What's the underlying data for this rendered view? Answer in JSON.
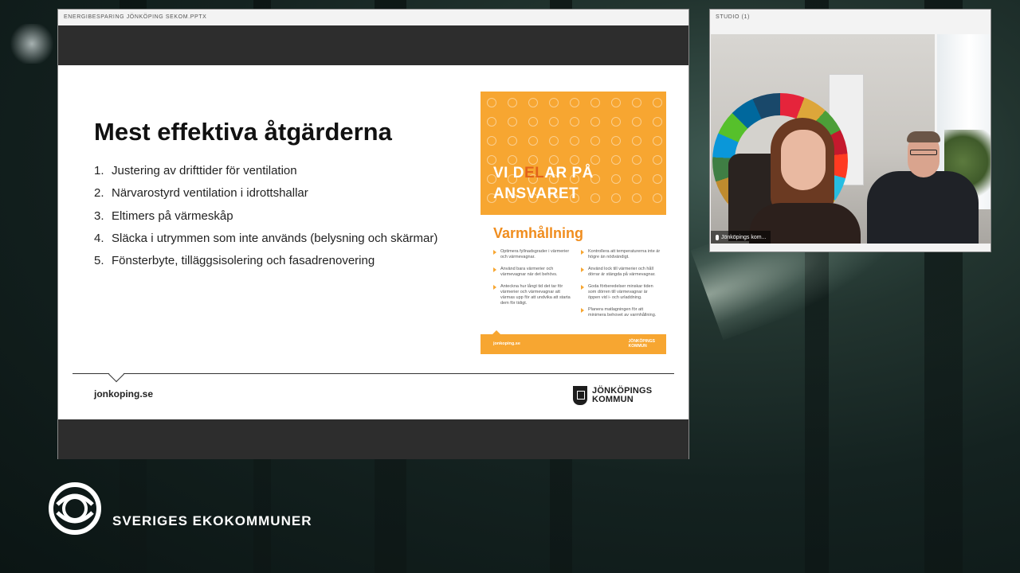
{
  "slide_window": {
    "title": "ENERGIBESPARING JÖNKÖPING SEKOM.PPTX"
  },
  "slide": {
    "title": "Mest effektiva åtgärderna",
    "items": [
      {
        "num": "1.",
        "text": "Justering av drifttider för ventilation"
      },
      {
        "num": "2.",
        "text": "Närvarostyrd ventilation i idrottshallar"
      },
      {
        "num": "3.",
        "text": "Eltimers på värmeskåp"
      },
      {
        "num": "4.",
        "text": "Släcka i utrymmen som inte används (belysning och skärmar)"
      },
      {
        "num": "5.",
        "text": "Fönsterbyte, tilläggsisolering och fasadrenovering"
      }
    ],
    "footer_url": "jonkoping.se",
    "logo_line1": "JÖNKÖPINGS",
    "logo_line2": "KOMMUN"
  },
  "poster": {
    "headline_part1": "VI D",
    "headline_el": "EL",
    "headline_part2": "AR PÅ",
    "headline_line2": "ANSVARET",
    "subtitle": "Varmhållning",
    "left_col": [
      "Optimera fyllnadsgrader i värmerier och värmevagnar.",
      "Använd bara värmerier och värmevagnar när det behövs.",
      "Anteckna hur långt tid det tar för värmerier och värmevagnar att värmas upp för att undvika att starta dem för tidigt."
    ],
    "right_col": [
      "Kontrollera att temperaturerna inte är högre än nödvändigt.",
      "Använd lock till värmerier och håll dörrar är stängda på värmevagnar.",
      "Goda förberedelser minskar tiden som dörren till värmevagnar är öppen vid i- och urladdning.",
      "Planera matlagningen för att minimera behovet av varmhållning."
    ],
    "bottom_url": "jonkoping.se",
    "bottom_logo_line1": "JÖNKÖPINGS",
    "bottom_logo_line2": "KOMMUN"
  },
  "studio": {
    "title": "STUDIO (1)",
    "name_tag": "Jönköpings kom..."
  },
  "brand": {
    "name": "SVERIGES EKOKOMMUNER"
  }
}
